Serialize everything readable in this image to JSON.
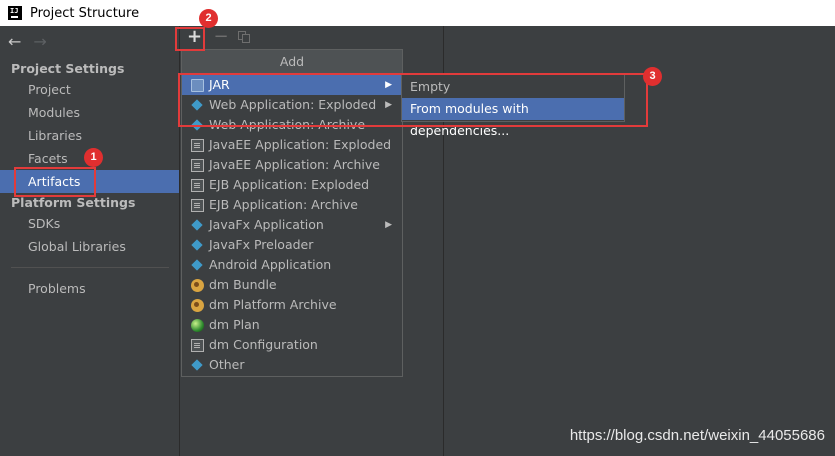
{
  "window": {
    "title": "Project Structure",
    "icon_text": "IJ"
  },
  "nav": {
    "back_icon": "←",
    "forward_icon": "→"
  },
  "sidebar": {
    "project_settings_title": "Project Settings",
    "project_settings_items": [
      {
        "label": "Project"
      },
      {
        "label": "Modules"
      },
      {
        "label": "Libraries"
      },
      {
        "label": "Facets"
      },
      {
        "label": "Artifacts",
        "selected": true
      }
    ],
    "platform_settings_title": "Platform Settings",
    "platform_settings_items": [
      {
        "label": "SDKs"
      },
      {
        "label": "Global Libraries"
      }
    ],
    "problems_label": "Problems"
  },
  "toolbar": {
    "add_icon": "+",
    "remove_icon": "−"
  },
  "add_menu": {
    "header": "Add",
    "items": [
      {
        "label": "JAR",
        "icon": "jar-icon",
        "submenu": true,
        "highlighted": true
      },
      {
        "label": "Web Application: Exploded",
        "icon": "web-icon",
        "submenu": true
      },
      {
        "label": "Web Application: Archive",
        "icon": "web-icon"
      },
      {
        "label": "JavaEE Application: Exploded",
        "icon": "javaee-icon"
      },
      {
        "label": "JavaEE Application: Archive",
        "icon": "javaee-icon"
      },
      {
        "label": "EJB Application: Exploded",
        "icon": "ejb-icon"
      },
      {
        "label": "EJB Application: Archive",
        "icon": "ejb-icon"
      },
      {
        "label": "JavaFx Application",
        "icon": "javafx-icon",
        "submenu": true
      },
      {
        "label": "JavaFx Preloader",
        "icon": "javafx-icon"
      },
      {
        "label": "Android Application",
        "icon": "android-icon"
      },
      {
        "label": "dm Bundle",
        "icon": "bundle-icon"
      },
      {
        "label": "dm Platform Archive",
        "icon": "bundle-icon"
      },
      {
        "label": "dm Plan",
        "icon": "plan-icon"
      },
      {
        "label": "dm Configuration",
        "icon": "config-icon"
      },
      {
        "label": "Other",
        "icon": "other-icon"
      }
    ],
    "submenu_arrow": "▶"
  },
  "jar_submenu": {
    "items": [
      {
        "label": "Empty"
      },
      {
        "label": "From modules with dependencies...",
        "highlighted": true
      }
    ]
  },
  "annotations": {
    "badge_1": "1",
    "badge_2": "2",
    "badge_3": "3",
    "color": "#e23b3b"
  },
  "watermark": "https://blog.csdn.net/weixin_44055686",
  "colors": {
    "background": "#3c3f41",
    "selection": "#4b6eaf",
    "text": "#bbbbbb"
  }
}
